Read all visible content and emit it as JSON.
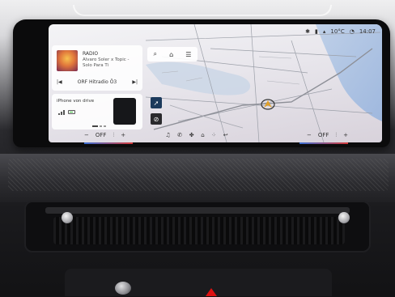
{
  "status_bar": {
    "temperature": "10°C",
    "time": "14:07",
    "icons": [
      "bluetooth-icon",
      "battery-icon",
      "signal-icon",
      "wifi-icon"
    ]
  },
  "media": {
    "source": "RADIO",
    "track": "Alvaro Soler x Topic - Solo Para Ti",
    "station": "ORF Hitradio Ö3",
    "prev_icon": "skip-back-icon",
    "next_icon": "skip-forward-icon"
  },
  "phone": {
    "label": "iPhone von drive"
  },
  "map_toolbar": [
    "search-icon",
    "home-icon",
    "list-icon"
  ],
  "climate": {
    "left_minus": "−",
    "left_value": "OFF",
    "left_plus": "+",
    "right_minus": "−",
    "right_value": "OFF",
    "right_plus": "+"
  },
  "dock_apps": [
    "music-icon",
    "phone-icon",
    "fan-icon",
    "home-icon",
    "apps-icon",
    "back-icon"
  ],
  "colors": {
    "heat_red": "#d43a3a",
    "cool_blue": "#3a6ed4",
    "nav_marker": "#e0a02a"
  }
}
